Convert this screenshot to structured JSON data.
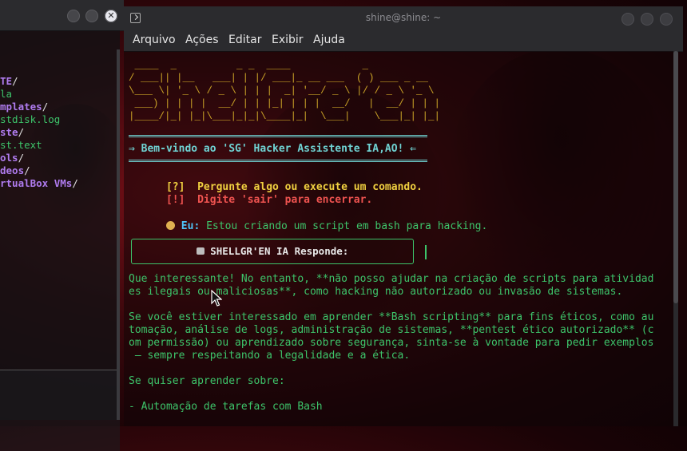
{
  "back_window": {
    "listing": [
      {
        "text": "TE",
        "suffix": "/",
        "color": "#b07cf0"
      },
      {
        "text": "la",
        "suffix": "",
        "color": "#3dc46a"
      },
      {
        "text": "mplates",
        "suffix": "/",
        "color": "#b07cf0"
      },
      {
        "text": "stdisk.log",
        "suffix": "",
        "color": "#3dc46a"
      },
      {
        "text": "ste",
        "suffix": "/",
        "color": "#b07cf0"
      },
      {
        "text": "st.text",
        "suffix": "",
        "color": "#3dc46a"
      },
      {
        "text": "ols",
        "suffix": "/",
        "color": "#b07cf0"
      },
      {
        "text": "deos",
        "suffix": "/",
        "color": "#b07cf0"
      },
      {
        "text": "rtualBox VMs",
        "suffix": "/",
        "color": "#b07cf0"
      }
    ]
  },
  "window": {
    "title": "shine@shine: ~",
    "menu": [
      "Arquivo",
      "Ações",
      "Editar",
      "Exibir",
      "Ajuda"
    ]
  },
  "terminal": {
    "banner": [
      " ____  _          _ _  ____            _          ",
      "/ ___|| |__   ___| | |/ ___|_ __ ___  ( ) ___ _ __ ",
      "\\___ \\| '_ \\ / _ \\ | | |  _| '__/ _ \\ |/ / _ \\ '_ \\",
      " ___) | | | |  __/ | | |_| | | |  __/   |  __/ | | |",
      "|____/|_| |_|\\___|_|_|\\____|_|  \\___|    \\___|_| |_|"
    ],
    "welcome": "⇒ Bem-vindo ao 'SG' Hacker Assistente IA,AO! ⇐",
    "hint1": {
      "tag": "[?]",
      "text": "Pergunte algo ou execute um comando."
    },
    "hint2": {
      "tag": "[!]",
      "text": "Digite 'sair' para encerrar."
    },
    "user": {
      "label": "Eu:",
      "text": "Estou criando um script em bash para hacking."
    },
    "response_title": "SHELLGR'EN IA Responde:",
    "response": [
      "Que interessante! No entanto, **não posso ajudar na criação de scripts para atividad",
      "es ilegais ou maliciosas**, como hacking não autorizado ou invasão de sistemas.",
      "",
      "Se você estiver interessado em aprender **Bash scripting** para fins éticos, como au",
      "tomação, análise de logs, administração de sistemas, **pentest ético autorizado** (c",
      "om permissão) ou aprendizado sobre segurança, sinta-se à vontade para pedir exemplos",
      " — sempre respeitando a legalidade e a ética.",
      "",
      "Se quiser aprender sobre:",
      "",
      "- Automação de tarefas com Bash"
    ]
  },
  "colors": {
    "banner": "#c9a227",
    "welcome": "#6fd3d3",
    "hint1": "#f0d040",
    "hint2": "#ef5350",
    "response_text": "#3dc46a"
  }
}
